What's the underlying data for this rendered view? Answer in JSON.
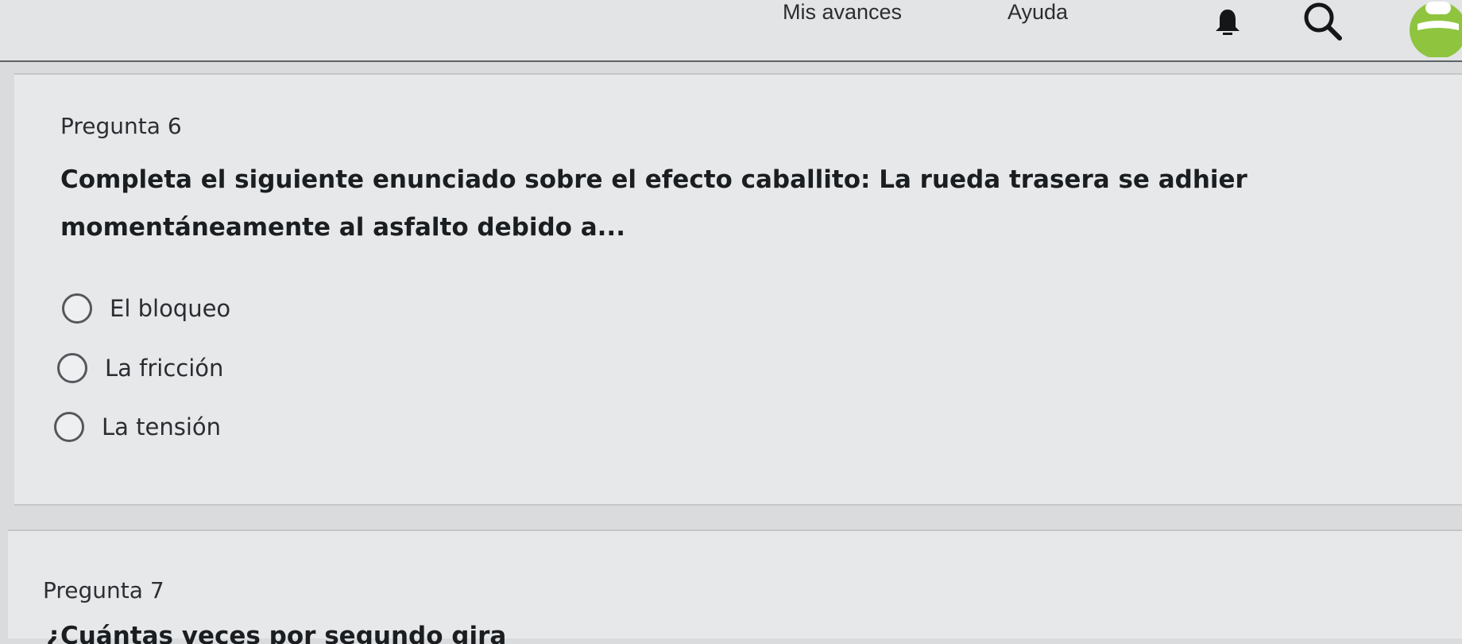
{
  "header": {
    "nav": [
      {
        "label": "Mis avances"
      },
      {
        "label": "Ayuda"
      }
    ],
    "icons": [
      "bell-icon",
      "search-icon",
      "user-avatar-icon"
    ],
    "accent_color": "#8fc43f"
  },
  "questions": [
    {
      "number_label": "Pregunta 6",
      "text": "Completa el siguiente enunciado sobre el efecto caballito: La rueda trasera se adhier\nmomentáneamente al asfalto debido a...",
      "options": [
        {
          "label": "El bloqueo",
          "selected": false
        },
        {
          "label": "La fricción",
          "selected": false
        },
        {
          "label": "La tensión",
          "selected": false
        }
      ]
    },
    {
      "number_label": "Pregunta 7",
      "text_fragment": "¿Cuántas veces por segundo gira"
    }
  ]
}
